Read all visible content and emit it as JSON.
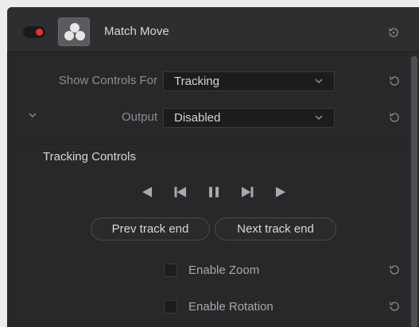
{
  "header": {
    "title": "Match Move",
    "toggle_state": "on",
    "toggle_color": "#e8302e",
    "icon": "davinci-resolve-fx-icon"
  },
  "controls": {
    "show_controls_for": {
      "label": "Show Controls For",
      "value": "Tracking"
    },
    "output": {
      "label": "Output",
      "value": "Disabled"
    }
  },
  "tracking": {
    "section_title": "Tracking Controls",
    "expanded": true,
    "transport": [
      "track-backward-icon",
      "step-backward-icon",
      "pause-icon",
      "step-forward-icon",
      "track-forward-icon"
    ],
    "prev_button": "Prev track end",
    "next_button": "Next track end",
    "enable_zoom": {
      "label": "Enable Zoom",
      "checked": false
    },
    "enable_rotation": {
      "label": "Enable Rotation",
      "checked": false
    }
  }
}
